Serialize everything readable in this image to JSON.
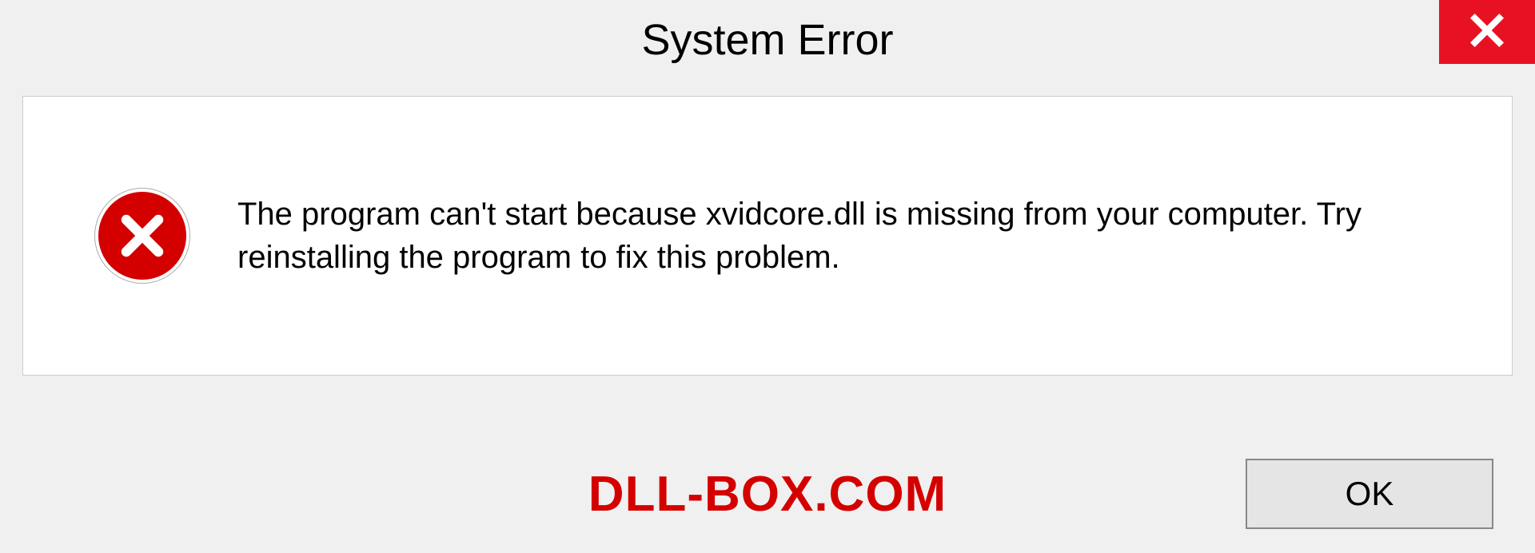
{
  "dialog": {
    "title": "System Error",
    "message": "The program can't start because xvidcore.dll is missing from your computer. Try reinstalling the program to fix this problem.",
    "ok_label": "OK"
  },
  "watermark": "DLL-BOX.COM",
  "colors": {
    "error_red": "#d40000",
    "close_red": "#e81123"
  }
}
